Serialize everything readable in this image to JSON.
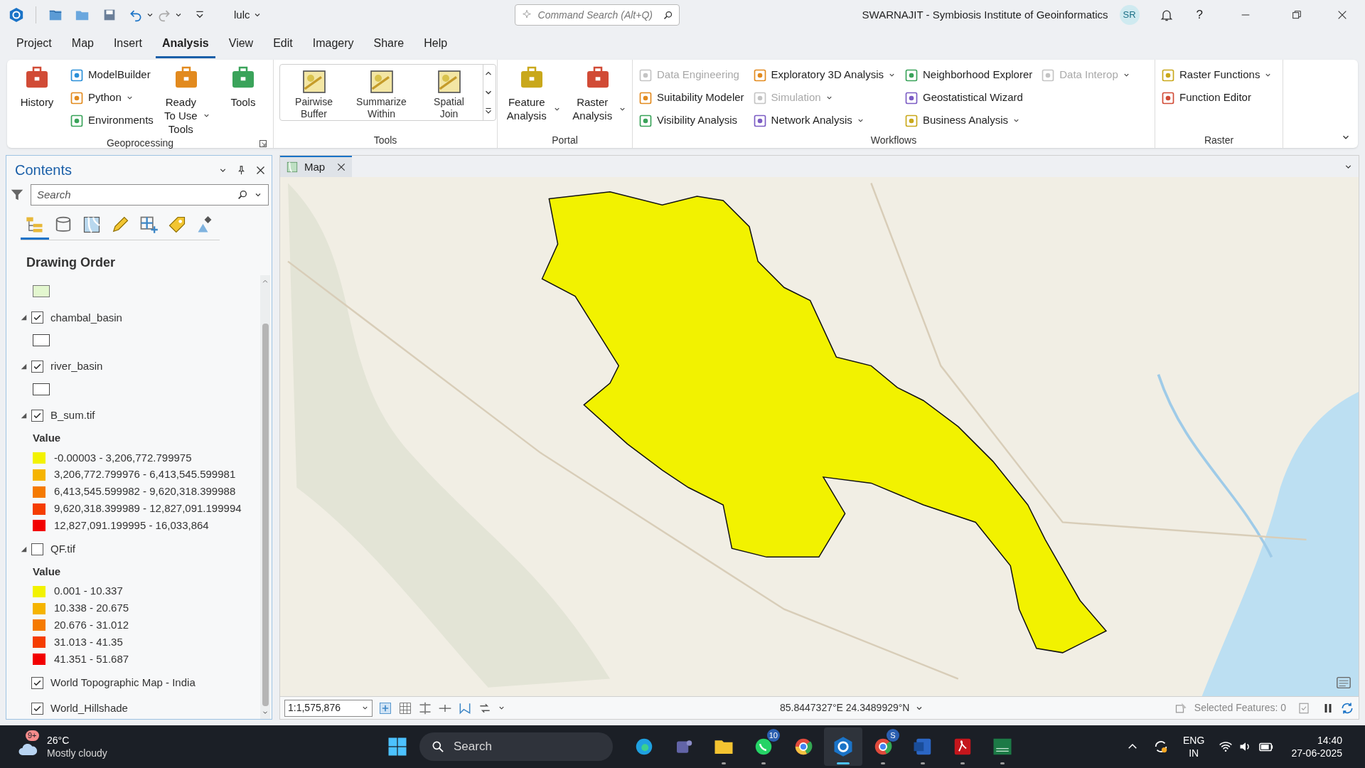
{
  "title_bar": {
    "project": "lulc",
    "command_search": {
      "placeholder": "Command Search (Alt+Q)"
    },
    "title": "SWARNAJIT - Symbiosis Institute of Geoinformatics",
    "user_initials": "SR",
    "help": "?"
  },
  "menu_tabs": [
    {
      "label": "Project",
      "selected": false
    },
    {
      "label": "Map",
      "selected": false
    },
    {
      "label": "Insert",
      "selected": false
    },
    {
      "label": "Analysis",
      "selected": true
    },
    {
      "label": "View",
      "selected": false
    },
    {
      "label": "Edit",
      "selected": false
    },
    {
      "label": "Imagery",
      "selected": false
    },
    {
      "label": "Share",
      "selected": false
    },
    {
      "label": "Help",
      "selected": false
    }
  ],
  "ribbon": {
    "groups": [
      {
        "title": "Geoprocessing",
        "launcher": true,
        "columns": [
          {
            "kind": "large",
            "label": "History",
            "dropdown": false
          },
          {
            "kind": "stack",
            "items": [
              {
                "label": "ModelBuilder",
                "dropdown": false,
                "disabled": false
              },
              {
                "label": "Python",
                "dropdown": true,
                "disabled": false
              },
              {
                "label": "Environments",
                "dropdown": false,
                "disabled": false
              }
            ]
          },
          {
            "kind": "large",
            "label": "Ready To Use Tools",
            "dropdown": true
          },
          {
            "kind": "large",
            "label": "Tools",
            "dropdown": false
          }
        ]
      },
      {
        "title": "Tools",
        "launcher": false,
        "columns": [
          {
            "kind": "gallery",
            "items": [
              "Pairwise Buffer",
              "Summarize Within",
              "Spatial Join"
            ]
          }
        ]
      },
      {
        "title": "Portal",
        "launcher": false,
        "columns": [
          {
            "kind": "large",
            "label": "Feature Analysis",
            "dropdown": true
          },
          {
            "kind": "large",
            "label": "Raster Analysis",
            "dropdown": true
          }
        ]
      },
      {
        "title": "Workflows",
        "launcher": false,
        "columns": [
          {
            "kind": "stack",
            "items": [
              {
                "label": "Data Engineering",
                "dropdown": false,
                "disabled": true
              },
              {
                "label": "Suitability Modeler",
                "dropdown": false,
                "disabled": false
              },
              {
                "label": "Visibility Analysis",
                "dropdown": false,
                "disabled": false
              }
            ]
          },
          {
            "kind": "stack",
            "items": [
              {
                "label": "Exploratory 3D Analysis",
                "dropdown": true,
                "disabled": false
              },
              {
                "label": "Simulation",
                "dropdown": true,
                "disabled": true
              },
              {
                "label": "Network Analysis",
                "dropdown": true,
                "disabled": false
              }
            ]
          },
          {
            "kind": "stack",
            "items": [
              {
                "label": "Neighborhood Explorer",
                "dropdown": false,
                "disabled": false
              },
              {
                "label": "Geostatistical Wizard",
                "dropdown": false,
                "disabled": false
              },
              {
                "label": "Business Analysis",
                "dropdown": true,
                "disabled": false
              }
            ]
          },
          {
            "kind": "stack",
            "items": [
              {
                "label": "Data Interop",
                "dropdown": true,
                "disabled": true
              }
            ]
          }
        ]
      },
      {
        "title": "Raster",
        "launcher": false,
        "columns": [
          {
            "kind": "stack",
            "items": [
              {
                "label": "Raster Functions",
                "dropdown": true,
                "disabled": false
              },
              {
                "label": "Function Editor",
                "dropdown": false,
                "disabled": false
              }
            ]
          }
        ]
      }
    ]
  },
  "contents": {
    "title": "Contents",
    "search": {
      "placeholder": "Search"
    },
    "view_tabs": [
      {
        "selected": true
      },
      {
        "selected": false
      },
      {
        "selected": false
      },
      {
        "selected": false
      },
      {
        "selected": false
      },
      {
        "selected": false
      },
      {
        "selected": false
      }
    ],
    "heading": "Drawing Order",
    "layers": [
      {
        "kind": "cut",
        "color": "#e3f7cf"
      },
      {
        "kind": "layer",
        "name": "chambal_basin",
        "checked": true,
        "expanded": true
      },
      {
        "kind": "layer",
        "name": "river_basin",
        "checked": true,
        "expanded": true
      },
      {
        "kind": "raster",
        "name": "B_sum.tif",
        "checked": true,
        "expanded": true,
        "legend_title": "Value",
        "classes": [
          {
            "label": "-0.00003 - 3,206,772.799975",
            "color": "#f2f200"
          },
          {
            "label": "3,206,772.799976 - 6,413,545.599981",
            "color": "#f5b400"
          },
          {
            "label": "6,413,545.599982 - 9,620,318.399988",
            "color": "#f57a00"
          },
          {
            "label": "9,620,318.399989 - 12,827,091.199994",
            "color": "#f53d00"
          },
          {
            "label": "12,827,091.199995 - 16,033,864",
            "color": "#f20000"
          }
        ]
      },
      {
        "kind": "raster",
        "name": "QF.tif",
        "checked": false,
        "expanded": true,
        "legend_title": "Value",
        "classes": [
          {
            "label": "0.001 - 10.337",
            "color": "#f2f200"
          },
          {
            "label": "10.338 - 20.675",
            "color": "#f5b400"
          },
          {
            "label": "20.676 - 31.012",
            "color": "#f57a00"
          },
          {
            "label": "31.013 - 41.35",
            "color": "#f53d00"
          },
          {
            "label": "41.351 - 51.687",
            "color": "#f20000"
          }
        ]
      },
      {
        "kind": "basemap",
        "name": "World Topographic Map - India",
        "checked": true
      },
      {
        "kind": "basemap",
        "name": "World_Hillshade",
        "checked": true
      }
    ]
  },
  "map_view": {
    "tab": {
      "label": "Map",
      "selected": true
    },
    "scale": "1:1,575,876",
    "coordinates": "85.8447327°E 24.3489929°N",
    "selected_features": "Selected Features: 0"
  },
  "taskbar": {
    "weather": {
      "badge": "9+",
      "temperature": "26°C",
      "condition": "Mostly cloudy"
    },
    "search": {
      "placeholder": "Search"
    },
    "apps": [
      {
        "running": false,
        "selected": false
      },
      {
        "running": false,
        "selected": false
      },
      {
        "running": true,
        "selected": false
      },
      {
        "running": true,
        "selected": false,
        "badge": "10"
      },
      {
        "running": false,
        "selected": false
      },
      {
        "running": true,
        "selected": true
      },
      {
        "running": true,
        "selected": false,
        "badge": "S"
      },
      {
        "running": true,
        "selected": false
      },
      {
        "running": true,
        "selected": false
      },
      {
        "running": true,
        "selected": false
      }
    ],
    "language": "ENG",
    "region": "IN",
    "time": "14:40",
    "date": "27-06-2025"
  }
}
